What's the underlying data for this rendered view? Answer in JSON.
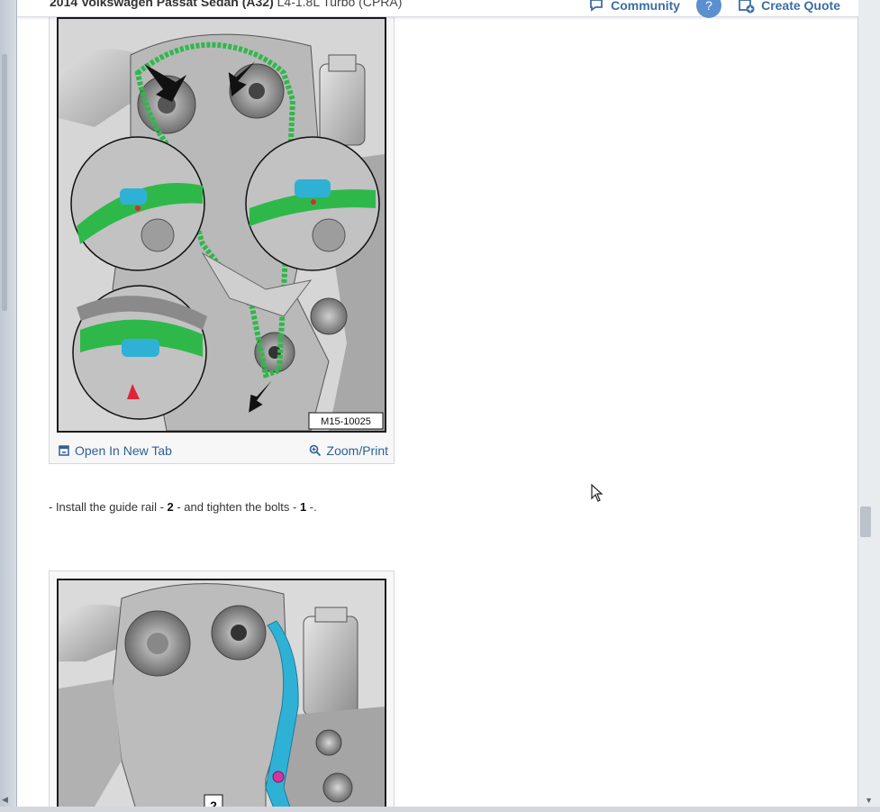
{
  "header": {
    "title_bold": "2014 Volkswagen Passat Sedan (A32)",
    "title_rest": " L4-1.8L Turbo (CPRA)",
    "community_label": "Community",
    "help_label": "?",
    "quote_label": "Create Quote"
  },
  "figure1": {
    "code_label": "M15-10025",
    "open_tab_label": "Open In New Tab",
    "zoom_label": "Zoom/Print"
  },
  "step": {
    "prefix": "-  Install the guide rail - ",
    "part1": "2",
    "middle": " - and tighten the bolts - ",
    "part2": "1",
    "suffix": " -."
  },
  "figure2": {
    "callout_label": "2"
  },
  "colors": {
    "link": "#2f5f96",
    "chain_green": "#2fb84a",
    "highlight_cyan": "#2fb1d6",
    "marker_red": "#e0233a"
  }
}
